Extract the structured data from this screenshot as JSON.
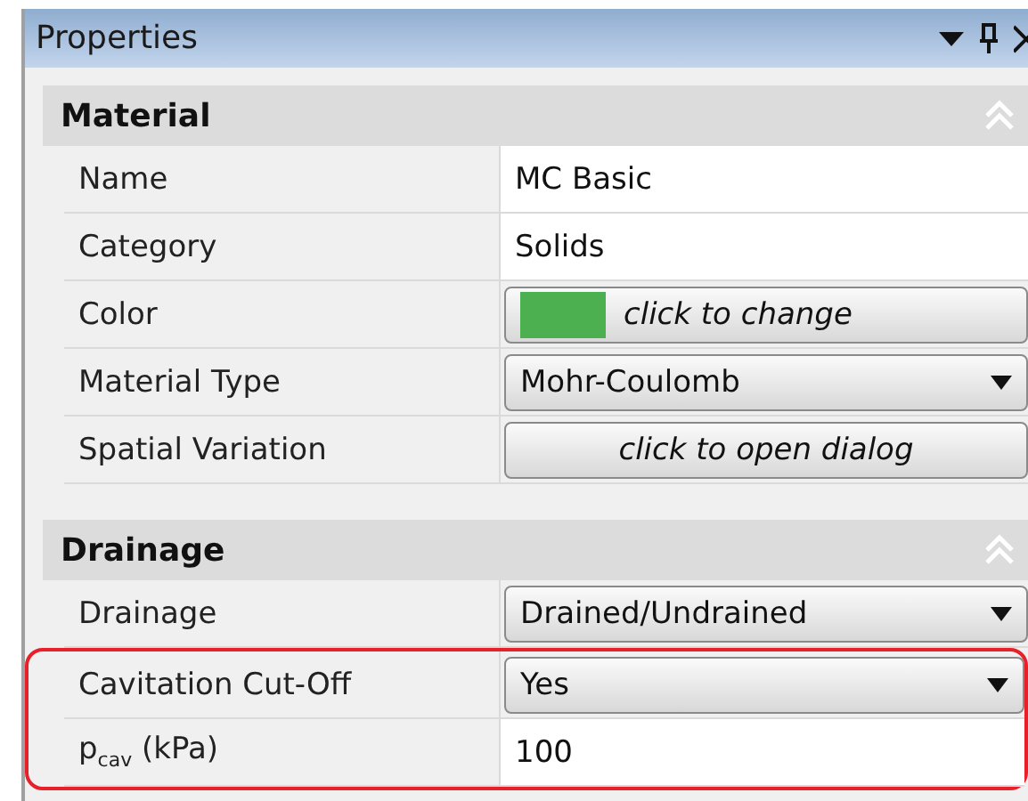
{
  "window": {
    "title": "Properties"
  },
  "sections": [
    {
      "title": "Material",
      "expanded": true,
      "rows": [
        {
          "label": "Name",
          "kind": "text",
          "value": "MC Basic",
          "highlighted": false
        },
        {
          "label": "Category",
          "kind": "text",
          "value": "Solids",
          "highlighted": false
        },
        {
          "label": "Color",
          "kind": "color_button",
          "value": "click to change",
          "color": "#4caf50",
          "highlighted": false
        },
        {
          "label": "Material Type",
          "kind": "dropdown",
          "value": "Mohr-Coulomb",
          "highlighted": false
        },
        {
          "label": "Spatial Variation",
          "kind": "button",
          "value": "click to open dialog",
          "highlighted": false
        }
      ]
    },
    {
      "title": "Drainage",
      "expanded": true,
      "rows": [
        {
          "label": "Drainage",
          "kind": "dropdown",
          "value": "Drained/Undrained",
          "highlighted": false
        },
        {
          "label": "Cavitation Cut-Off",
          "kind": "dropdown",
          "value": "Yes",
          "highlighted": true
        },
        {
          "label": "p$_{cav}$ (kPa)",
          "kind": "text",
          "value": "100",
          "highlighted": true
        }
      ]
    }
  ]
}
